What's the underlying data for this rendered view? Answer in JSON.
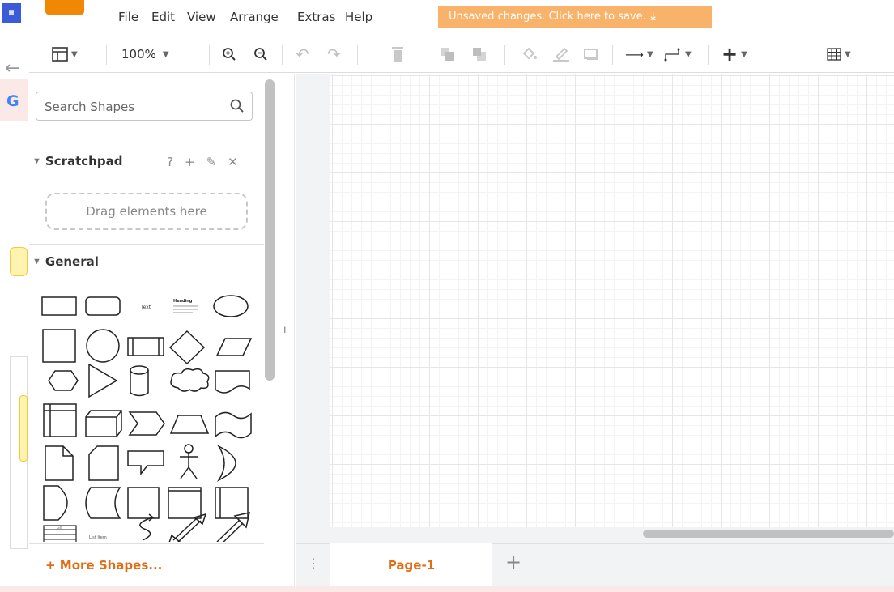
{
  "menu": {
    "items": [
      "File",
      "Edit",
      "View",
      "Arrange",
      "Extras",
      "Help"
    ],
    "save_banner": "Unsaved changes. Click here to save.",
    "save_banner_icon": "download-icon"
  },
  "toolbar": {
    "zoom": "100%",
    "icons": [
      "format-panel-icon",
      "zoom-in-icon",
      "zoom-out-icon",
      "undo-icon",
      "redo-icon",
      "delete-icon",
      "to-front-icon",
      "to-back-icon",
      "fill-color-icon",
      "line-color-icon",
      "shadow-icon",
      "connection-icon",
      "waypoints-icon",
      "insert-icon",
      "table-icon"
    ]
  },
  "sidebar": {
    "search_placeholder": "Search Shapes",
    "scratchpad": {
      "title": "Scratchpad",
      "actions": [
        "?",
        "+",
        "✎",
        "✕"
      ],
      "drop_hint": "Drag elements here"
    },
    "general": {
      "title": "General",
      "shape_labels": {
        "text": "Text",
        "heading": "Heading",
        "list": "List",
        "list_item": "List Item"
      }
    },
    "more_shapes": "+ More Shapes..."
  },
  "pages": {
    "tabs": [
      "Page-1"
    ],
    "menu_glyph": "⋮",
    "add_glyph": "+"
  },
  "colors": {
    "accent": "#e06c14",
    "banner": "#f8b26a",
    "logo": "#f08705"
  }
}
